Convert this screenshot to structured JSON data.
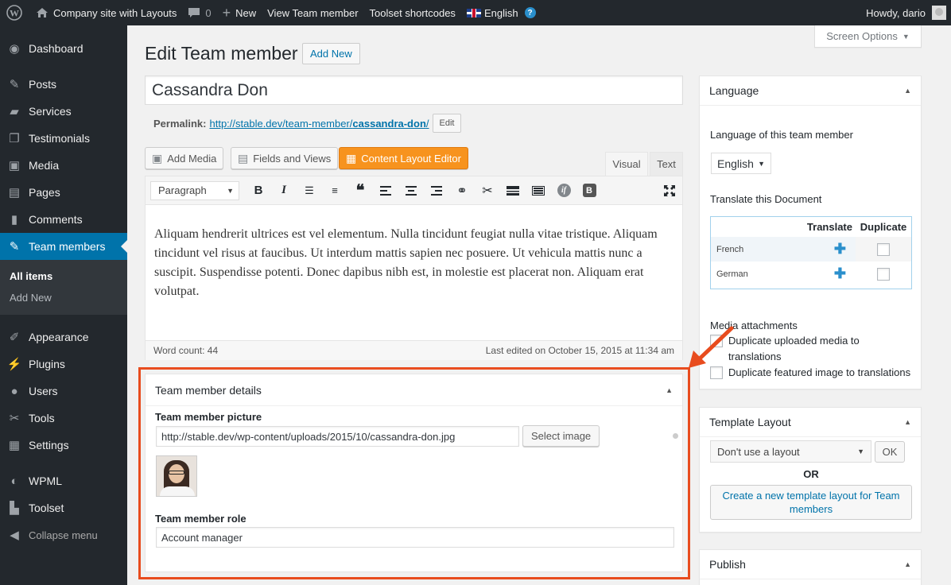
{
  "adminbar": {
    "site_name": "Company site with Layouts",
    "comments_count": "0",
    "new_label": "New",
    "view_label": "View Team member",
    "shortcodes_label": "Toolset shortcodes",
    "language_label": "English",
    "greeting": "Howdy, dario"
  },
  "sidebar": {
    "dashboard": "Dashboard",
    "posts": "Posts",
    "services": "Services",
    "testimonials": "Testimonials",
    "media": "Media",
    "pages": "Pages",
    "comments": "Comments",
    "team_members": "Team members",
    "all_items": "All items",
    "add_new": "Add New",
    "appearance": "Appearance",
    "plugins": "Plugins",
    "users": "Users",
    "tools": "Tools",
    "settings": "Settings",
    "wpml": "WPML",
    "toolset": "Toolset",
    "collapse": "Collapse menu"
  },
  "screen_options": "Screen Options",
  "page": {
    "title": "Edit Team member",
    "add_new": "Add New",
    "post_title": "Cassandra Don",
    "permalink_label": "Permalink:",
    "permalink_base": "http://stable.dev/team-member/",
    "permalink_slug": "cassandra-don",
    "permalink_end": "/",
    "permalink_edit": "Edit"
  },
  "editor": {
    "add_media": "Add Media",
    "fields_views": "Fields and Views",
    "content_layout": "Content Layout Editor",
    "tab_visual": "Visual",
    "tab_text": "Text",
    "format": "Paragraph",
    "content": "Aliquam hendrerit ultrices est vel elementum. Nulla tincidunt feugiat nulla vitae tristique. Aliquam tincidunt vel risus at faucibus. Ut interdum mattis sapien nec posuere. Ut vehicula mattis nunc a suscipit. Suspendisse potenti. Donec dapibus nibh est, in molestie est placerat non. Aliquam erat volutpat.",
    "word_count": "Word count: 44",
    "last_edited": "Last edited on October 15, 2015 at 11:34 am"
  },
  "team_details": {
    "heading": "Team member details",
    "picture_label": "Team member picture",
    "picture_url": "http://stable.dev/wp-content/uploads/2015/10/cassandra-don.jpg",
    "select_image": "Select image",
    "role_label": "Team member role",
    "role_value": "Account manager"
  },
  "language_box": {
    "heading": "Language",
    "lang_of_label": "Language of this team member",
    "selected_language": "English",
    "translate_label": "Translate this Document",
    "col_translate": "Translate",
    "col_duplicate": "Duplicate",
    "rows": [
      {
        "language": "French"
      },
      {
        "language": "German"
      }
    ],
    "media_label": "Media attachments",
    "dup_media": "Duplicate uploaded media to translations",
    "dup_featured": "Duplicate featured image to translations"
  },
  "template_box": {
    "heading": "Template Layout",
    "selected": "Don't use a layout",
    "ok": "OK",
    "or": "OR",
    "create": "Create a new template layout for Team members"
  },
  "publish_box": {
    "heading": "Publish"
  },
  "colors": {
    "accent": "#0073aa",
    "highlight": "#e84c1e",
    "layout_button": "#f7931e"
  }
}
